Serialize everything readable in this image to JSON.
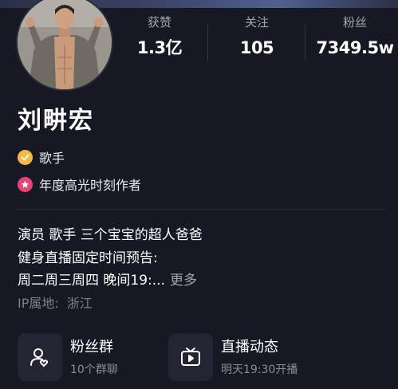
{
  "profile": {
    "name": "刘畊宏",
    "tags": [
      {
        "icon": "verified-check-icon",
        "label": "歌手",
        "color": "#f5b94a"
      },
      {
        "icon": "star-badge-icon",
        "label": "年度高光时刻作者",
        "color": "#e8437a"
      }
    ]
  },
  "stats": [
    {
      "label": "获赞",
      "value": "1.3亿"
    },
    {
      "label": "关注",
      "value": "105"
    },
    {
      "label": "粉丝",
      "value": "7349.5w"
    }
  ],
  "bio": {
    "line1": "演员 歌手 三个宝宝的超人爸爸",
    "line2": "健身直播固定时间预告:",
    "line3": "周二周三周四 晚间19:...",
    "more": "更多"
  },
  "ip": {
    "label": "IP属地:",
    "location": "浙江"
  },
  "cards": [
    {
      "icon": "fan-group-icon",
      "title": "粉丝群",
      "subtitle": "10个群聊"
    },
    {
      "icon": "live-tv-icon",
      "title": "直播动态",
      "subtitle": "明天19:30开播"
    }
  ]
}
